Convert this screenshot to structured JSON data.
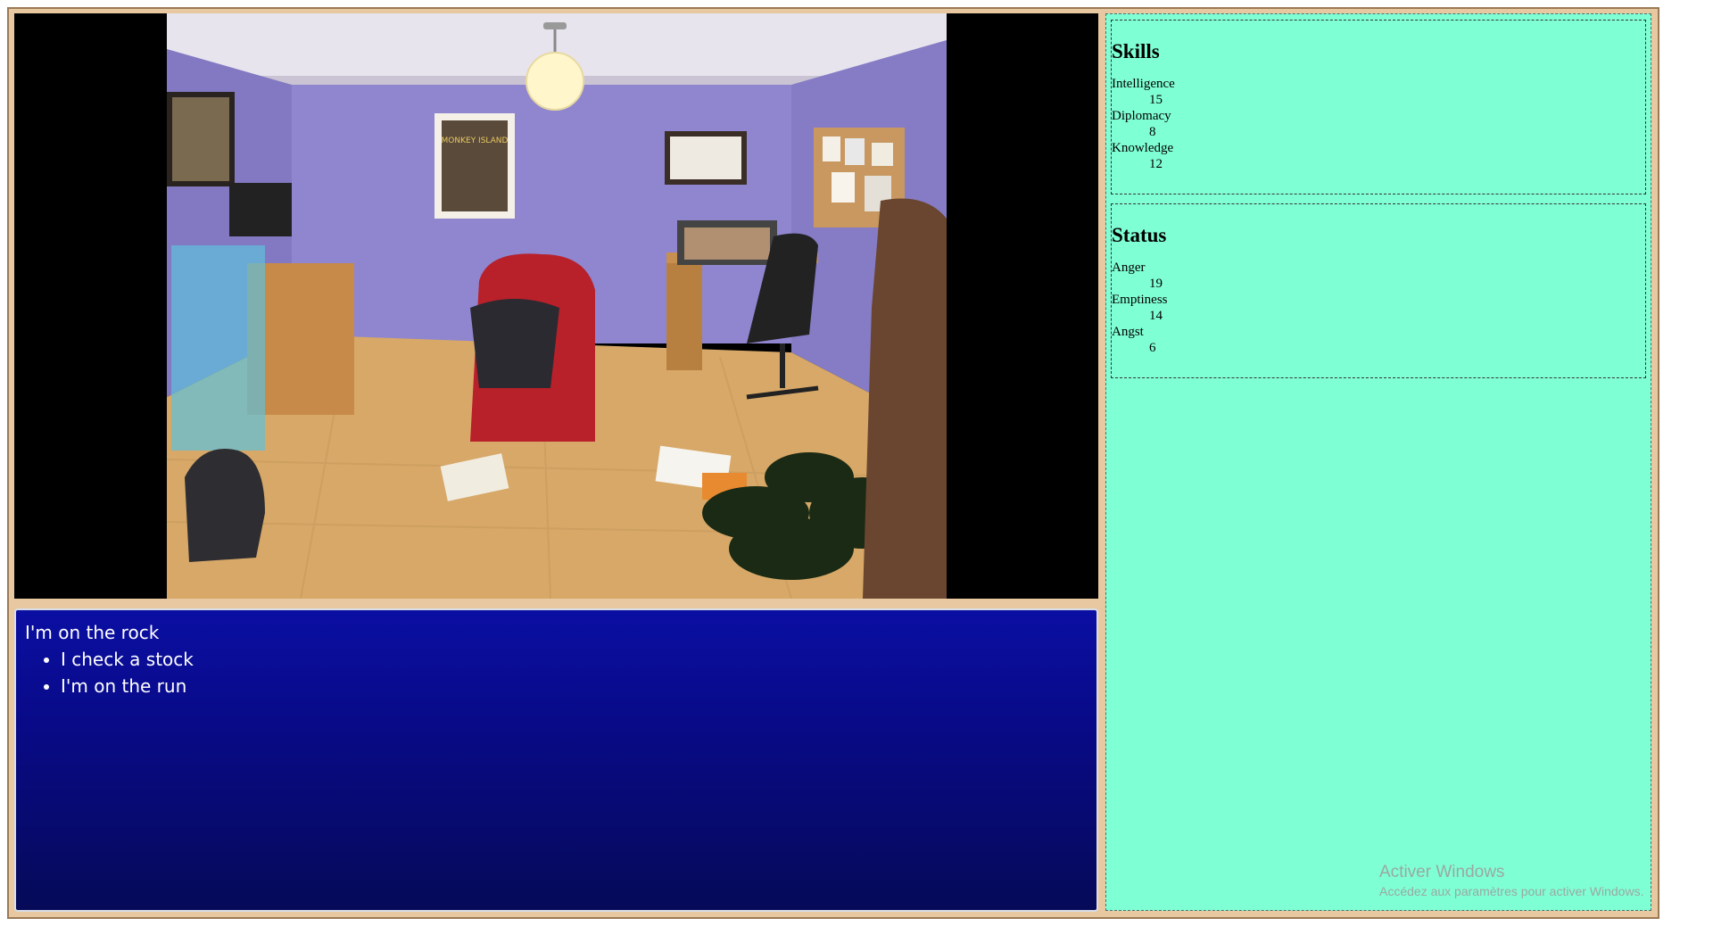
{
  "scene": {
    "image_alt": "Messy bedroom scene",
    "poster_text": "MONKEY ISLAND",
    "colors": {
      "wall": "#8f86cf",
      "ceiling": "#e7e4ee",
      "floor": "#d7a868",
      "chair": "#b8202a"
    }
  },
  "dialog": {
    "line": "I'm on the rock",
    "choices": [
      "I check a stock",
      "I'm on the run"
    ]
  },
  "skills": {
    "title": "Skills",
    "items": [
      {
        "name": "Intelligence",
        "value": "15"
      },
      {
        "name": "Diplomacy",
        "value": "8"
      },
      {
        "name": "Knowledge",
        "value": "12"
      }
    ]
  },
  "status": {
    "title": "Status",
    "items": [
      {
        "name": "Anger",
        "value": "19"
      },
      {
        "name": "Emptiness",
        "value": "14"
      },
      {
        "name": "Angst",
        "value": "6"
      }
    ]
  },
  "watermark": {
    "line1": "Activer Windows",
    "line2": "Accédez aux paramètres pour activer Windows."
  },
  "colors": {
    "frame": "#e8c8a0",
    "sidebar": "#7fffd4",
    "dialog_top": "#0b0fa2",
    "dialog_bottom": "#060a58"
  }
}
